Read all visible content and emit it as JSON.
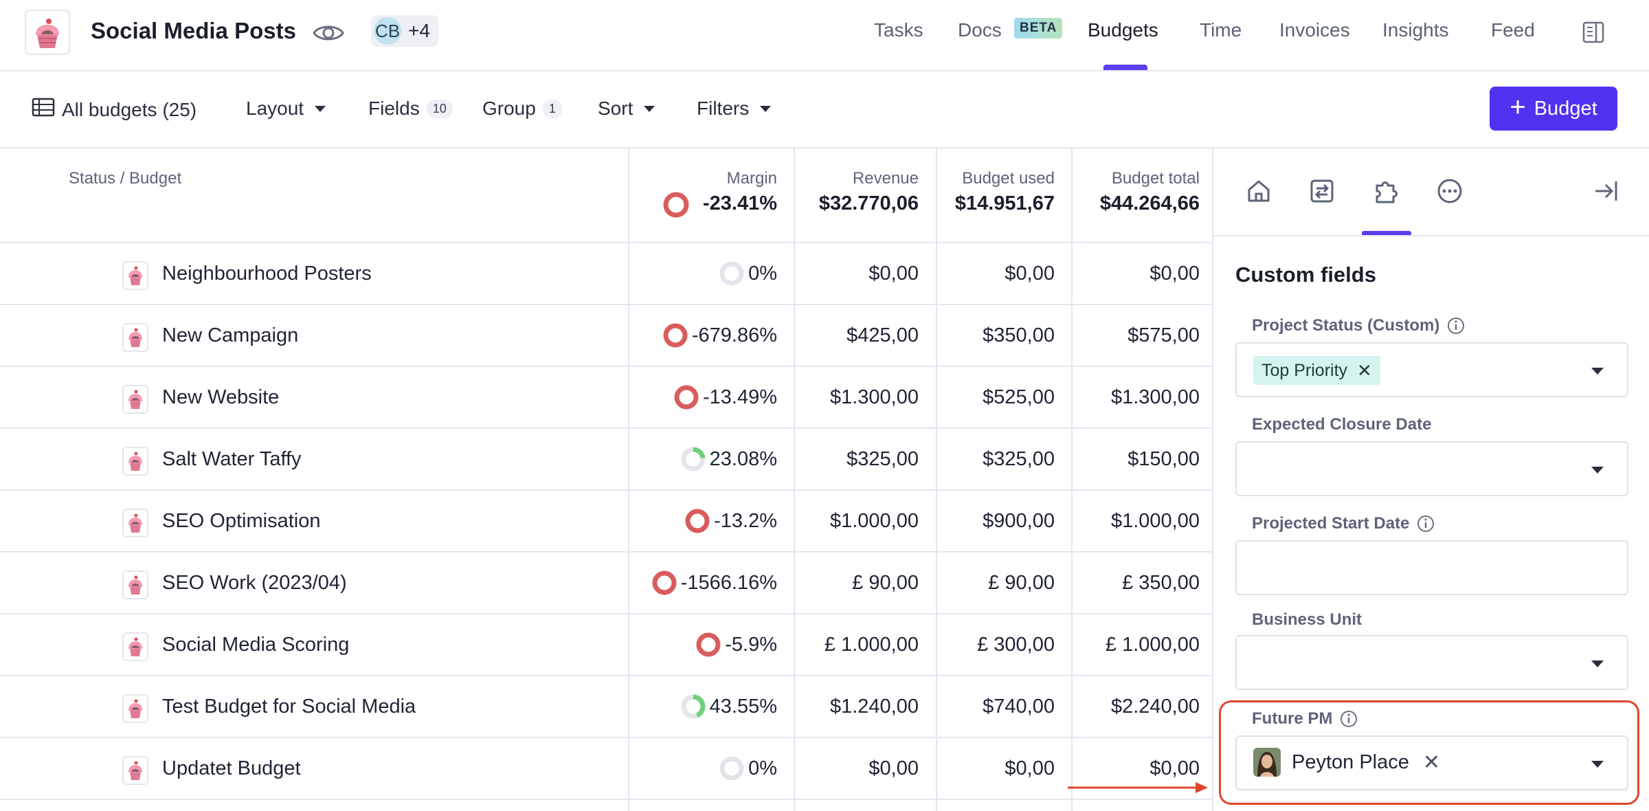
{
  "header": {
    "title": "Social Media Posts",
    "members": {
      "initials": "CB",
      "more": "+4"
    },
    "nav": [
      {
        "label": "Tasks",
        "active": false
      },
      {
        "label": "Docs",
        "active": false,
        "badge": "BETA"
      },
      {
        "label": "Budgets",
        "active": true
      },
      {
        "label": "Time",
        "active": false
      },
      {
        "label": "Invoices",
        "active": false
      },
      {
        "label": "Insights",
        "active": false
      },
      {
        "label": "Feed",
        "active": false
      }
    ]
  },
  "toolbar": {
    "view": "All budgets (25)",
    "layout": "Layout",
    "fields": "Fields",
    "fields_count": "10",
    "group": "Group",
    "group_count": "1",
    "sort": "Sort",
    "filters": "Filters",
    "new_button": "Budget"
  },
  "table": {
    "columns": {
      "name": "Status / Budget",
      "margin": "Margin",
      "revenue": "Revenue",
      "used": "Budget used",
      "total": "Budget total"
    },
    "totals": {
      "margin": "-23.41%",
      "revenue": "$32.770,06",
      "used": "$14.951,67",
      "total": "$44.264,66"
    },
    "rows": [
      {
        "name": "Neighbourhood Posters",
        "margin": "0%",
        "revenue": "$0,00",
        "used": "$0,00",
        "total": "$0,00",
        "margin_fill": 0
      },
      {
        "name": "New Campaign",
        "margin": "-679.86%",
        "revenue": "$425,00",
        "used": "$350,00",
        "total": "$575,00",
        "margin_fill": -1
      },
      {
        "name": "New Website",
        "margin": "-13.49%",
        "revenue": "$1.300,00",
        "used": "$525,00",
        "total": "$1.300,00",
        "margin_fill": -1
      },
      {
        "name": "Salt Water Taffy",
        "margin": "23.08%",
        "revenue": "$325,00",
        "used": "$325,00",
        "total": "$150,00",
        "margin_fill": 0.2308
      },
      {
        "name": "SEO Optimisation",
        "margin": "-13.2%",
        "revenue": "$1.000,00",
        "used": "$900,00",
        "total": "$1.000,00",
        "margin_fill": -1
      },
      {
        "name": "SEO Work (2023/04)",
        "margin": "-1566.16%",
        "revenue": "£ 90,00",
        "used": "£ 90,00",
        "total": "£ 350,00",
        "margin_fill": -1
      },
      {
        "name": "Social Media Scoring",
        "margin": "-5.9%",
        "revenue": "£ 1.000,00",
        "used": "£ 300,00",
        "total": "£ 1.000,00",
        "margin_fill": -1
      },
      {
        "name": "Test Budget for Social Media",
        "margin": "43.55%",
        "revenue": "$1.240,00",
        "used": "$740,00",
        "total": "$2.240,00",
        "margin_fill": 0.4355
      },
      {
        "name": "Updatet Budget",
        "margin": "0%",
        "revenue": "$0,00",
        "used": "$0,00",
        "total": "$0,00",
        "margin_fill": 0
      }
    ]
  },
  "panel": {
    "title": "Custom fields",
    "tabs": [
      "home-icon",
      "transfer-icon",
      "puzzle-icon",
      "more-icon"
    ],
    "fields": {
      "project_status": {
        "label": "Project Status (Custom)",
        "value": "Top Priority"
      },
      "expected_closure": {
        "label": "Expected Closure Date",
        "value": ""
      },
      "projected_start": {
        "label": "Projected Start Date",
        "value": ""
      },
      "business_unit": {
        "label": "Business Unit",
        "value": ""
      },
      "future_pm": {
        "label": "Future PM",
        "value": "Peyton Place"
      }
    }
  },
  "colors": {
    "accent": "#5232f0",
    "negative_ring": "#d95c5c",
    "positive_ring": "#6fcf7a",
    "neutral_ring": "#e3e5ea",
    "annotation": "#e2452c"
  }
}
